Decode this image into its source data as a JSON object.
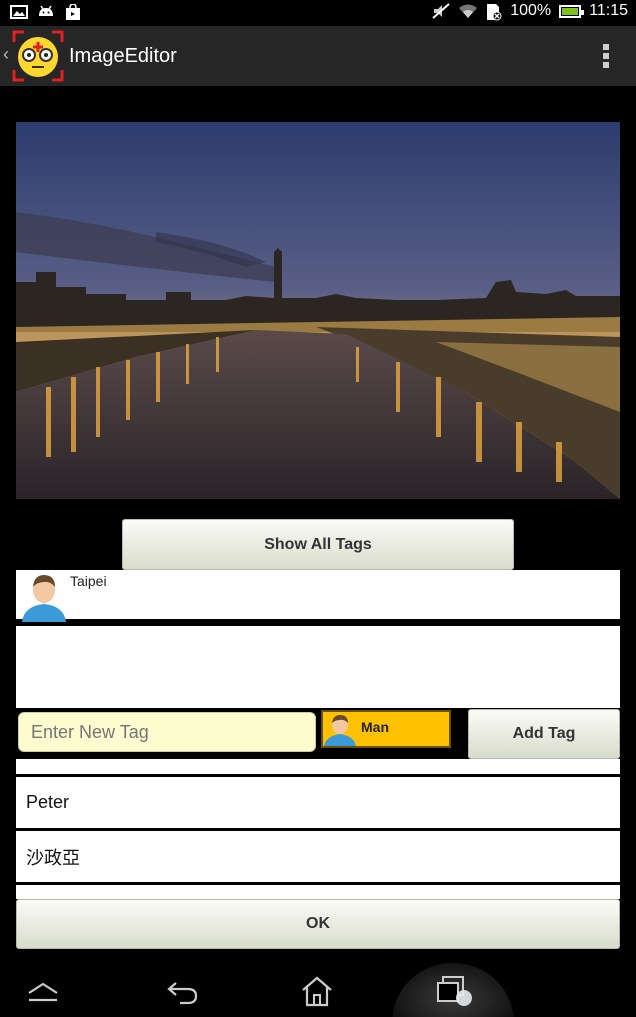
{
  "status_bar": {
    "battery_text": "100%",
    "time": "11:15",
    "icons": [
      "image-icon",
      "android-icon",
      "shopping-bag-icon",
      "mute-icon",
      "wifi-icon",
      "sd-card-icon",
      "battery-icon"
    ]
  },
  "action_bar": {
    "title": "ImageEditor",
    "icon": "app-face-icon"
  },
  "photo": {
    "subject": "city-river-night-icon"
  },
  "buttons": {
    "show_all_tags": "Show All Tags",
    "add_tag": "Add Tag",
    "ok": "OK"
  },
  "tags": [
    {
      "name": "Taipei",
      "icon": "person-avatar-icon"
    }
  ],
  "new_tag": {
    "placeholder": "Enter New Tag",
    "type_chip_label": "Man",
    "type_chip_icon": "person-avatar-icon"
  },
  "suggestions": [
    {
      "label": "Peter"
    },
    {
      "label": "沙政亞"
    }
  ],
  "colors": {
    "action_bar": "#262626",
    "chip": "#ffc100",
    "input_bg": "#fdfccf",
    "battery": "#7cc41d"
  }
}
